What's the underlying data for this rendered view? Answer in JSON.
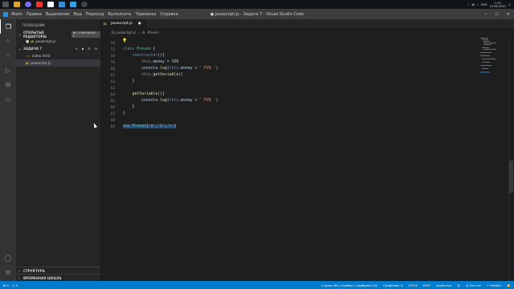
{
  "taskbar": {
    "tray": {
      "time": "1:10",
      "date": "15.06.2020",
      "lang": "ENG"
    }
  },
  "titlebar": {
    "menu": [
      "Файл",
      "Правка",
      "Выделение",
      "Вид",
      "Переход",
      "Выполнить",
      "Терминал",
      "Справка"
    ],
    "window_title": "● javascript.js - Задача 7 - Visual Studio Code"
  },
  "sidebar": {
    "title": "ПРОВОДНИК",
    "open_editors": {
      "label": "ОТКРЫТЫЕ РЕДАКТОРЫ",
      "badge": "НЕ СОХРАНЕНО: 1",
      "files": [
        "javascript.js"
      ]
    },
    "folder": {
      "label": "ЗАДАЧА 7",
      "files": [
        "index.html",
        "javascript.js"
      ]
    },
    "outline_label": "СТРУКТУРА",
    "timeline_label": "ВРЕМЕННАЯ ШКАЛА"
  },
  "editor": {
    "tab_label": "javascript.js",
    "breadcrumb": {
      "file": "JS javascript.js",
      "symbol": "Preson"
    },
    "lines": [
      {
        "n": "56",
        "text": ""
      },
      {
        "n": "57",
        "text": "class Preson {"
      },
      {
        "n": "58",
        "text": "    constructor(){"
      },
      {
        "n": "59",
        "text": "        this.money = 500"
      },
      {
        "n": "60",
        "text": "        console.log(this.money + ' РУБ.')"
      },
      {
        "n": "61",
        "text": "        this.getVariable()"
      },
      {
        "n": "62",
        "text": "    }"
      },
      {
        "n": "63",
        "text": ""
      },
      {
        "n": "64",
        "text": "    getVariable(){"
      },
      {
        "n": "65",
        "text": "        console.log(this.money + ' РУБ.')"
      },
      {
        "n": "66",
        "text": "    }"
      },
      {
        "n": "67",
        "text": "}"
      },
      {
        "n": "68",
        "text": ""
      },
      {
        "n": "69",
        "text": "new Preson('a','b','c')"
      }
    ]
  },
  "statusbar": {
    "errors": "0",
    "warnings": "0",
    "position": "Строка 69, столбец 1 (выбрано 24)",
    "spaces": "Пробелов: 4",
    "encoding": "UTF-8",
    "eol": "CRLF",
    "language": "JavaScript",
    "golive": "Go Live",
    "prettier": "Prettier"
  }
}
